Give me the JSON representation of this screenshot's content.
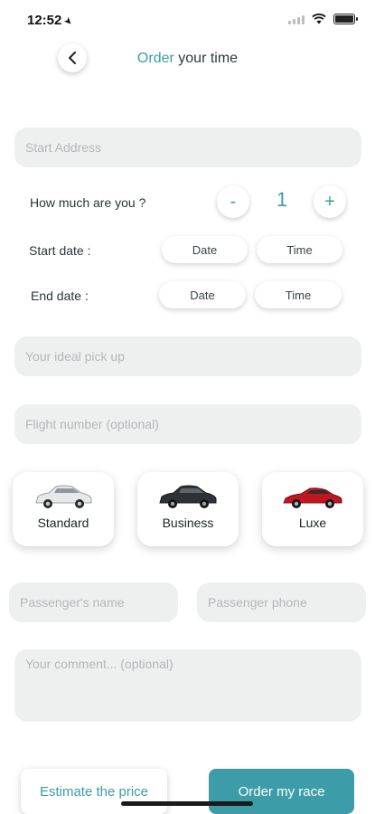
{
  "status_bar": {
    "time": "12:52",
    "location_icon": "location-arrow-icon",
    "wifi_icon": "wifi-icon",
    "battery_icon": "battery-icon"
  },
  "header": {
    "back_icon": "chevron-left-icon",
    "title_accent": "Order",
    "title_rest": " your time"
  },
  "form": {
    "start_address_placeholder": "Start Address",
    "quantity_label": "How much are you ?",
    "quantity_minus": "-",
    "quantity_value": "1",
    "quantity_plus": "+",
    "start_date_label": "Start date :",
    "end_date_label": "End date :",
    "date_label": "Date",
    "time_label": "Time",
    "pickup_placeholder": "Your ideal pick up",
    "flight_placeholder": "Flight number (optional)",
    "passenger_name_placeholder": "Passenger's name",
    "passenger_phone_placeholder": "Passenger phone",
    "comment_placeholder": "Your comment... (optional)"
  },
  "vehicles": [
    {
      "label": "Standard",
      "color": "#e8eaec"
    },
    {
      "label": "Business",
      "color": "#2e3236"
    },
    {
      "label": "Luxe",
      "color": "#c0161f"
    }
  ],
  "actions": {
    "estimate_label": "Estimate the price",
    "order_label": "Order my race"
  },
  "colors": {
    "accent": "#3c9ca8",
    "field_bg": "#eef0f0"
  }
}
